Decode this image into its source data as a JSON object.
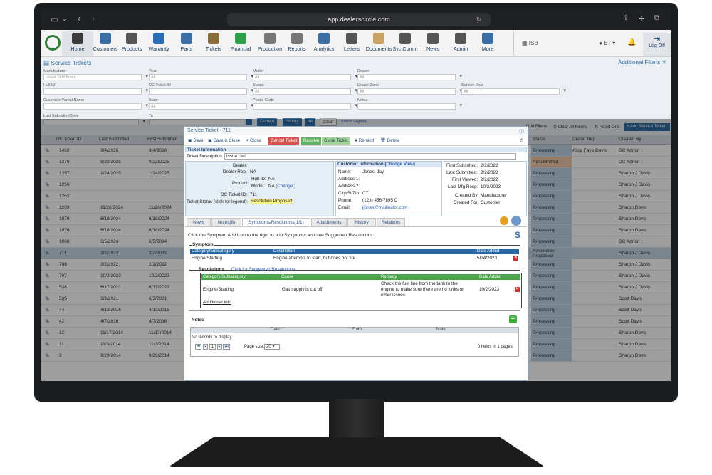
{
  "browser": {
    "url": "app.dealerscircle.com"
  },
  "nav": {
    "items": [
      {
        "label": "Home",
        "color": "#3b3b3b"
      },
      {
        "label": "Customers",
        "color": "#3b6ea5"
      },
      {
        "label": "Products",
        "color": "#555555"
      },
      {
        "label": "Warranty",
        "color": "#2a6db5"
      },
      {
        "label": "Parts",
        "color": "#3b6ea5"
      },
      {
        "label": "Tickets",
        "color": "#8a6d3b"
      },
      {
        "label": "Financial",
        "color": "#2e9e4a"
      },
      {
        "label": "Production",
        "color": "#777777"
      },
      {
        "label": "Reports",
        "color": "#777777"
      },
      {
        "label": "Analytics",
        "color": "#3b6ea5"
      },
      {
        "label": "Letters",
        "color": "#555555"
      },
      {
        "label": "Documents",
        "color": "#c8a165"
      },
      {
        "label": "Svc Comm",
        "color": "#555555"
      },
      {
        "label": "News",
        "color": "#555555"
      },
      {
        "label": "Admin",
        "color": "#555555"
      },
      {
        "label": "More",
        "color": "#3b6ea5"
      }
    ],
    "isb": "ISB",
    "et": "ET",
    "logoff": "Log Off"
  },
  "page": {
    "title": "Service Tickets",
    "additional_filters": "Additional Filters"
  },
  "filters": {
    "manufacturer_label": "Manufacturer",
    "manufacturer_value": "Island Skiff Boats",
    "year_label": "Year",
    "year_value": "All",
    "model_label": "Model",
    "model_value": "All",
    "dealer_label": "Dealer",
    "dealer_value": "All",
    "hull_label": "Hull ID",
    "dc_ticket_label": "DC Ticket ID",
    "status_label": "Status",
    "status_value": "All",
    "dealer_zone_label": "Dealer Zone",
    "dealer_zone_value": "All",
    "service_rep_label": "Service Rep",
    "service_rep_value": "All",
    "customer_partial_label": "Customer Partial Name",
    "state_label": "State",
    "state_value": "All",
    "postal_label": "Postal Code",
    "notes_label": "Notes",
    "last_submitted_label": "Last Submitted Date",
    "to_label": "To",
    "btn_current": "Current",
    "btn_history": "History",
    "btn_all": "All",
    "btn_clear": "Clear",
    "status_legend": "Status Legend"
  },
  "gridbar": {
    "grid_filters": "Grid Filters",
    "clear_all": "Clear All Filters",
    "reset_grid": "Reset Grid",
    "add_ticket": "Add Service Ticket"
  },
  "grid": {
    "headers": [
      "DC Ticket ID",
      "Last Submitted",
      "First Submitted",
      "Status",
      "Dealer Rep",
      "Created By"
    ],
    "rows": [
      {
        "id": "1462",
        "last": "3/4/2026",
        "first": "3/4/2026",
        "status": "Processing",
        "rep": "Alice Faye Davis",
        "by": "DC Admin"
      },
      {
        "id": "1378",
        "last": "9/22/2025",
        "first": "9/22/2025",
        "status": "Resubmitted",
        "rep": "",
        "by": "DC Admin"
      },
      {
        "id": "1257",
        "last": "1/24/2025",
        "first": "1/24/2025",
        "status": "Processing",
        "rep": "",
        "by": "Sharon J Davis"
      },
      {
        "id": "1256",
        "last": "",
        "first": "",
        "status": "Processing",
        "rep": "",
        "by": "Sharon J Davis"
      },
      {
        "id": "1252",
        "last": "",
        "first": "",
        "status": "Processing",
        "rep": "",
        "by": "Sharon J Davis"
      },
      {
        "id": "1209",
        "last": "11/26/2024",
        "first": "11/26/2024",
        "status": "Processing",
        "rep": "",
        "by": "Sharon Davis"
      },
      {
        "id": "1079",
        "last": "6/18/2024",
        "first": "6/18/2024",
        "status": "Processing",
        "rep": "",
        "by": "Sharon Davis"
      },
      {
        "id": "1078",
        "last": "6/18/2024",
        "first": "6/18/2024",
        "status": "Processing",
        "rep": "",
        "by": "Sharon Davis"
      },
      {
        "id": "1068",
        "last": "6/5/2024",
        "first": "6/5/2024",
        "status": "Processing",
        "rep": "",
        "by": "DC Admin"
      },
      {
        "id": "711",
        "last": "2/2/2022",
        "first": "2/2/2022",
        "status": "Resolution Proposed",
        "rep": "",
        "by": "Sharon J Davis"
      },
      {
        "id": "708",
        "last": "2/2/2022",
        "first": "2/2/2022",
        "status": "Processing",
        "rep": "",
        "by": "Sharon J Davis"
      },
      {
        "id": "707",
        "last": "10/2/2023",
        "first": "10/2/2023",
        "status": "Processing",
        "rep": "",
        "by": "Sharon J Davis"
      },
      {
        "id": "538",
        "last": "6/17/2021",
        "first": "6/17/2021",
        "status": "Processing",
        "rep": "",
        "by": "Sharon J Davis"
      },
      {
        "id": "535",
        "last": "6/3/2021",
        "first": "6/3/2021",
        "status": "Processing",
        "rep": "",
        "by": "Scott Davis"
      },
      {
        "id": "44",
        "last": "4/13/2016",
        "first": "4/13/2016",
        "status": "Processing",
        "rep": "",
        "by": "Scott Davis"
      },
      {
        "id": "42",
        "last": "4/7/2016",
        "first": "4/7/2016",
        "status": "Processing",
        "rep": "",
        "by": "Scott Davis"
      },
      {
        "id": "12",
        "last": "11/17/2014",
        "first": "11/17/2014",
        "status": "Processing",
        "rep": "",
        "by": "Sharon Davis"
      },
      {
        "id": "11",
        "last": "11/3/2014",
        "first": "11/3/2014",
        "status": "Processing",
        "rep": "",
        "by": "Sharon Davis"
      },
      {
        "id": "2",
        "last": "9/29/2014",
        "first": "9/29/2014",
        "status": "Processing",
        "rep": "",
        "by": "Sharon Davis"
      }
    ]
  },
  "modal": {
    "title": "Service Ticket - 711",
    "toolbar": {
      "save": "Save",
      "save_close": "Save & Close",
      "close": "Close",
      "cancel": "Cancel Ticket",
      "resolve": "Resolve",
      "close_ticket": "Close Ticket",
      "remind": "Remind",
      "delete": "Delete"
    },
    "ticket_info": "Ticket Information",
    "ticket_desc_label": "Ticket Description:",
    "ticket_desc_value": "issue call",
    "dealer_label": "Dealer:",
    "dealer_rep_label": "Dealer Rep:",
    "dealer_rep_value": "NA",
    "product_label": "Product",
    "hull_label": "Hull ID:",
    "hull_value": "NA",
    "model_label": "Model:",
    "model_value": "NA (",
    "change": "Change",
    " model_close": ")",
    "dc_ticket_label": "DC Ticket ID:",
    "dc_ticket_value": "711",
    "status_label": "Ticket Status (click for legend):",
    "status_value": "Resolution Proposed",
    "cust_title": "Customer Information (",
    "cust_change": "Change View",
    "cust_title_end": ")",
    "cust": {
      "name_l": "Name:",
      "name": "Jones, Jay",
      "a1_l": "Address 1:",
      "a2_l": "Address 2:",
      "city_l": "City/St/Zip:",
      "city": "CT",
      "phone_l": "Phone:",
      "phone": "(123) 456-7895 C",
      "email_l": "Email:",
      "email": "jjones@mailinator.com"
    },
    "dates": {
      "fs_l": "First Submitted:",
      "fs": "2/2/2022",
      "ls_l": "Last Submitted:",
      "ls": "2/2/2022",
      "fv_l": "First Viewed:",
      "fv": "2/2/2022",
      "lm_l": "Last Mfg Resp:",
      "lm": "10/2/2023",
      "cb_l": "Created By:",
      "cb": "Manufacturer",
      "cf_l": "Created For:",
      "cf": "Customer"
    },
    "tabs": [
      "News",
      "Notes(8)",
      "Symptoms/Resolutions(1/1)",
      "Attachments",
      "History",
      "Relations"
    ],
    "instruction": "Click the Symptom Add icon to the right to add Symptoms and see Suggested Resolutions.",
    "symptom": {
      "legend": "Symptom",
      "h_cat": "Category/Subcategory",
      "h_desc": "Description",
      "h_date": "Date Added",
      "cat": "Engine/Starting",
      "desc": "Engine attempts to start, but does not fire.",
      "date": "5/24/2023"
    },
    "resolutions": {
      "label": "Resolutions",
      "link": "Click for Suggested Resolutions",
      "h_cat": "Category/Subcategory",
      "h_cause": "Cause",
      "h_remedy": "Remedy",
      "h_date": "Date Added",
      "cat": "Engine/Starting",
      "cause": "Gas supply is cut off",
      "remedy1": "Check the fuel line from the tank to the",
      "remedy2": "engine to make sure there are no kinks or",
      "remedy3": "other issues.",
      "date": "10/2/2023",
      "additional": "Additional Info"
    },
    "notes": {
      "label": "Notes",
      "h_date": "Date",
      "h_from": "From",
      "h_note": "Note",
      "empty": "No records to display.",
      "page": "1",
      "page_size_label": "Page size:",
      "page_size": "20",
      "items": "0 items in 1 pages"
    }
  }
}
